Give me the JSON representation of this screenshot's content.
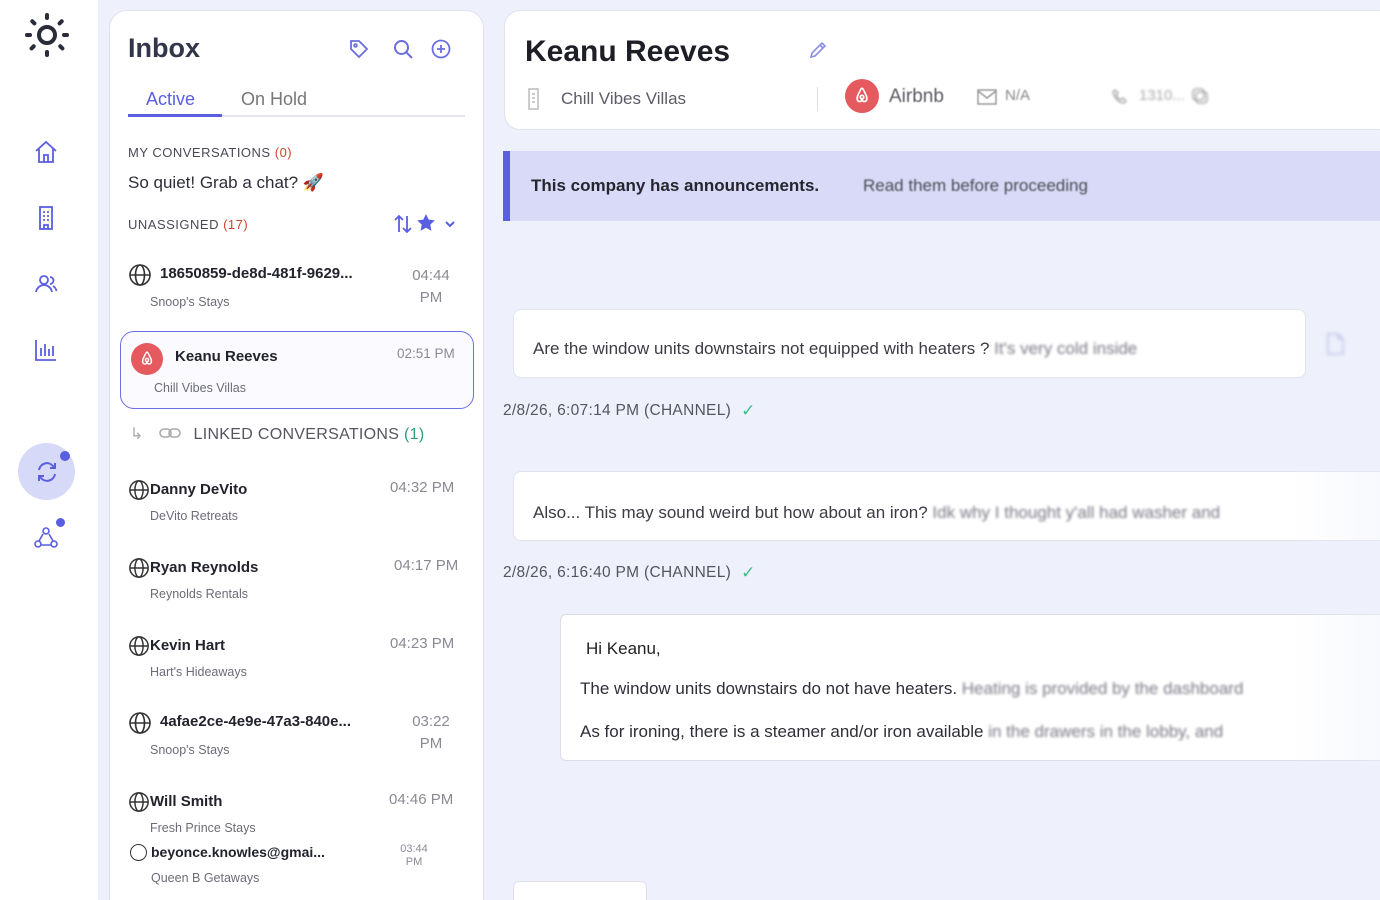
{
  "rail": {
    "items": [
      "home-icon",
      "building-icon",
      "users-icon",
      "analytics-icon",
      "sync-icon",
      "team-icon"
    ],
    "accent": "#5a5ee0"
  },
  "inbox": {
    "title": "Inbox",
    "tabs": [
      "Active",
      "On Hold"
    ],
    "my_conversations": {
      "label": "MY CONVERSATIONS",
      "count": "(0)",
      "empty_text": "So quiet! Grab a chat? 🚀"
    },
    "unassigned": {
      "label": "UNASSIGNED",
      "count": "(17)"
    },
    "linked": {
      "label": "LINKED CONVERSATIONS",
      "count": "(1)"
    },
    "conversations": [
      {
        "name": "18650859-de8d-481f-9629...",
        "sub": "Snoop's Stays",
        "time": "04:44 PM"
      },
      {
        "name": "Keanu Reeves",
        "sub": "Chill Vibes Villas",
        "time": "02:51 PM"
      },
      {
        "name": "Danny DeVito",
        "sub": "DeVito Retreats",
        "time": "04:32 PM"
      },
      {
        "name": "Ryan Reynolds",
        "sub": "Reynolds Rentals",
        "time": "04:17 PM"
      },
      {
        "name": "Kevin Hart",
        "sub": "Hart's Hideaways",
        "time": "04:23 PM"
      },
      {
        "name": "4afae2ce-4e9e-47a3-840e...",
        "sub": "Snoop's Stays",
        "time": "03:22 PM"
      },
      {
        "name": "Will Smith",
        "sub": "Fresh Prince Stays",
        "time": "04:46 PM"
      },
      {
        "name": "beyonce.knowles@gmai...",
        "sub": "Queen B Getaways",
        "time": "03:44 PM"
      }
    ]
  },
  "header": {
    "name": "Keanu Reeves",
    "company": "Chill Vibes Villas",
    "channel": "Airbnb",
    "email": "N/A",
    "phone": "1310..."
  },
  "banner": {
    "bold": "This company has announcements.",
    "rest": "Read them before proceeding"
  },
  "messages": [
    {
      "text_visible": "Are the window units downstairs not equipped with heaters ?",
      "text_blur": "It's very cold inside",
      "meta": "2/8/26, 6:07:14 PM (CHANNEL)"
    },
    {
      "text_visible": "Also... This may sound weird but how about an iron?",
      "text_blur": "Idk why I thought y'all had washer and",
      "meta": "2/8/26, 6:16:40 PM (CHANNEL)"
    }
  ],
  "reply": {
    "greeting": "Hi Keanu,",
    "line1_visible": "The window units downstairs do not have heaters.",
    "line1_blur": "Heating is provided by the dashboard",
    "line2_visible": "As for ironing, there is a steamer and/or iron available",
    "line2_blur": "in the drawers in the lobby, and"
  }
}
